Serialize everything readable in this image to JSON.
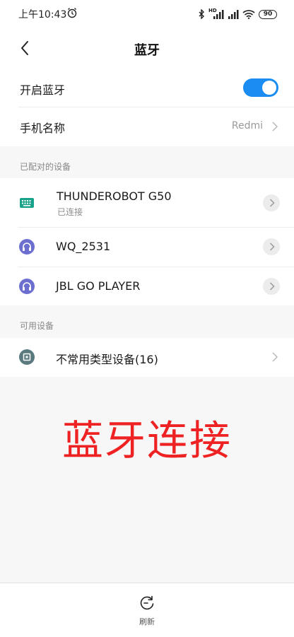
{
  "status_bar": {
    "time": "上午10:43",
    "battery": "90",
    "signal_labels": [
      "HD"
    ]
  },
  "header": {
    "title": "蓝牙"
  },
  "settings": {
    "bluetooth_toggle_label": "开启蓝牙",
    "bluetooth_enabled": true,
    "device_name_label": "手机名称",
    "device_name_value": "Redmi"
  },
  "paired": {
    "section_title": "已配对的设备",
    "devices": [
      {
        "name": "THUNDEROBOT G50",
        "status": "已连接",
        "icon": "keyboard-icon"
      },
      {
        "name": "WQ_2531",
        "icon": "headset-icon"
      },
      {
        "name": "JBL GO PLAYER",
        "icon": "headset-icon"
      }
    ]
  },
  "available": {
    "section_title": "可用设备",
    "devices": [
      {
        "name": "不常用类型设备(16)",
        "icon": "device-icon"
      }
    ]
  },
  "overlay": {
    "text": "蓝牙连接"
  },
  "bottom": {
    "refresh_label": "刷新"
  },
  "colors": {
    "accent": "#1a8cf2",
    "keyboard_icon": "#1aa38a",
    "headset_icon": "#6c6fcf",
    "device_icon": "#5a7a80",
    "overlay_text": "#ee2222"
  }
}
